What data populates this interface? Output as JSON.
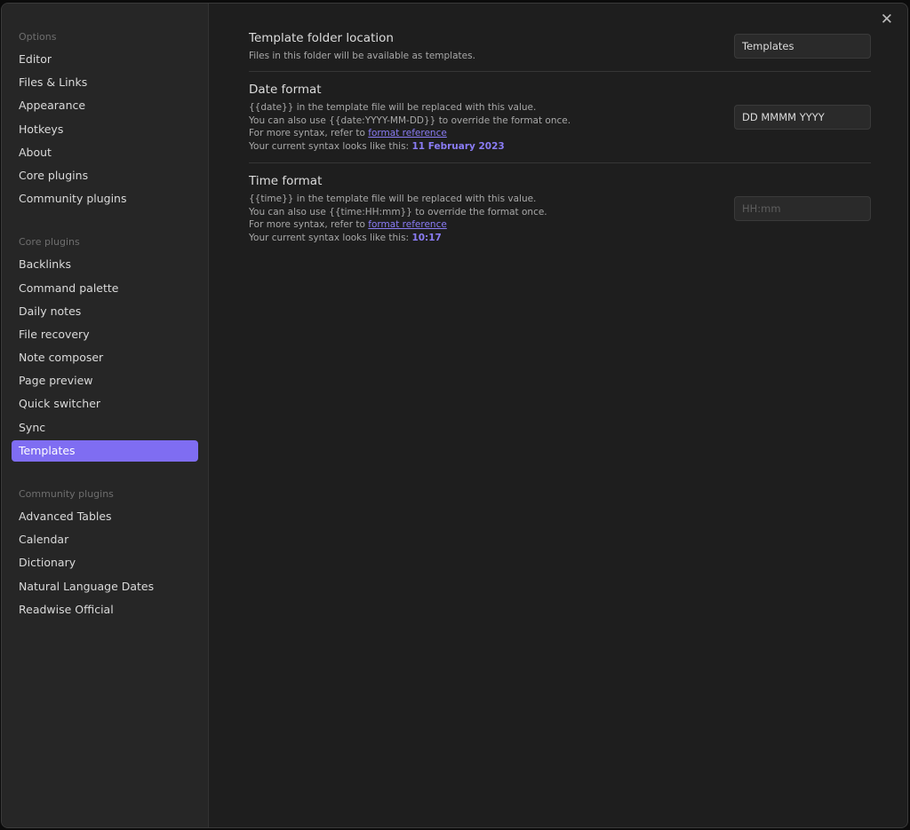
{
  "sidebar": {
    "options_header": "Options",
    "options": [
      "Editor",
      "Files & Links",
      "Appearance",
      "Hotkeys",
      "About",
      "Core plugins",
      "Community plugins"
    ],
    "core_header": "Core plugins",
    "core": [
      "Backlinks",
      "Command palette",
      "Daily notes",
      "File recovery",
      "Note composer",
      "Page preview",
      "Quick switcher",
      "Sync",
      "Templates"
    ],
    "community_header": "Community plugins",
    "community": [
      "Advanced Tables",
      "Calendar",
      "Dictionary",
      "Natural Language Dates",
      "Readwise Official"
    ],
    "active": "Templates"
  },
  "close_icon": "close-x",
  "settings": {
    "folder": {
      "name": "Template folder location",
      "desc": "Files in this folder will be available as templates.",
      "value": "Templates"
    },
    "date": {
      "name": "Date format",
      "line1": "{{date}} in the template file will be replaced with this value.",
      "line2": "You can also use {{date:YYYY-MM-DD}} to override the format once.",
      "line3": "For more syntax, refer to ",
      "link": "format reference",
      "line4": "Your current syntax looks like this: ",
      "preview": "11 February 2023",
      "value": "DD MMMM YYYY"
    },
    "time": {
      "name": "Time format",
      "line1": "{{time}} in the template file will be replaced with this value.",
      "line2": "You can also use {{time:HH:mm}} to override the format once.",
      "line3": "For more syntax, refer to ",
      "link": "format reference",
      "line4": "Your current syntax looks like this: ",
      "preview": "10:17",
      "placeholder": "HH:mm"
    }
  },
  "accent_color": "#7f6df2"
}
